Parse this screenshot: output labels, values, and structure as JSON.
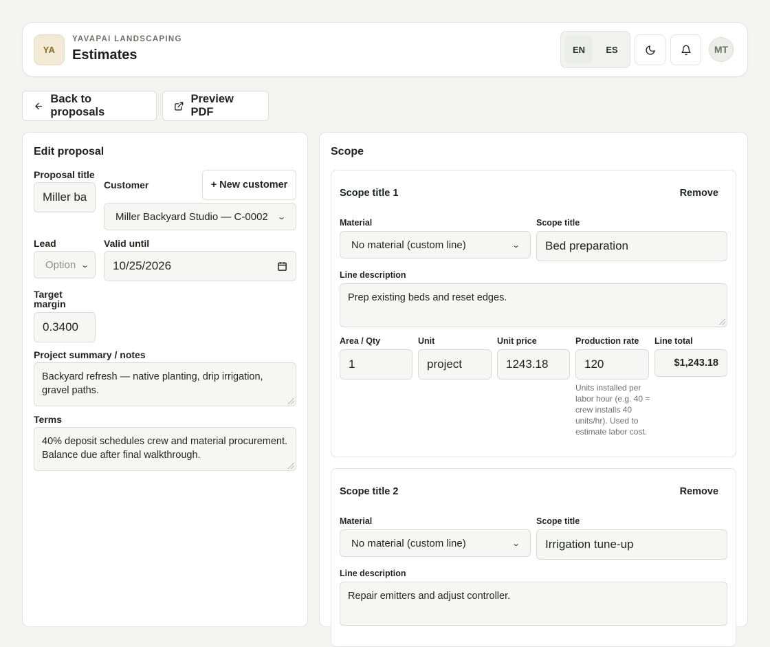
{
  "header": {
    "logo_initials": "YA",
    "company": "YAVAPAI LANDSCAPING",
    "title": "Estimates",
    "languages": [
      "EN",
      "ES"
    ],
    "active_language": "EN",
    "avatar_initials": "MT"
  },
  "actions": {
    "back_label": "Back to proposals",
    "preview_label": "Preview PDF"
  },
  "edit_proposal": {
    "heading": "Edit proposal",
    "proposal_title_label": "Proposal title",
    "proposal_title_value": "Miller ba",
    "customer_label": "Customer",
    "new_customer_label": "+ New customer",
    "customer_value": "Miller Backyard Studio — C-0002",
    "lead_label": "Lead",
    "lead_value": "Option",
    "valid_until_label": "Valid until",
    "valid_until_value": "10/25/2026",
    "target_margin_label": "Target margin",
    "target_margin_value": "0.3400",
    "summary_label": "Project summary / notes",
    "summary_value": "Backyard refresh — native planting, drip irrigation, gravel paths.",
    "terms_label": "Terms",
    "terms_value": "40% deposit schedules crew and material procurement. Balance due after final walkthrough."
  },
  "scope": {
    "heading": "Scope",
    "labels": {
      "remove": "Remove",
      "material": "Material",
      "scope_title": "Scope title",
      "line_description": "Line description",
      "area_qty": "Area / Qty",
      "unit": "Unit",
      "unit_price": "Unit price",
      "production_rate": "Production rate",
      "line_total": "Line total",
      "production_help": "Units installed per labor hour (e.g. 40 = crew installs 40 units/hr). Used to estimate labor cost."
    },
    "items": [
      {
        "heading": "Scope title 1",
        "material": "No material (custom line)",
        "title": "Bed preparation",
        "description": "Prep existing beds and reset edges.",
        "qty": "1",
        "unit": "project",
        "unit_price": "1243.18",
        "production_rate": "120",
        "line_total": "$1,243.18"
      },
      {
        "heading": "Scope title 2",
        "material": "No material (custom line)",
        "title": "Irrigation tune-up",
        "description": "Repair emitters and adjust controller."
      }
    ]
  }
}
